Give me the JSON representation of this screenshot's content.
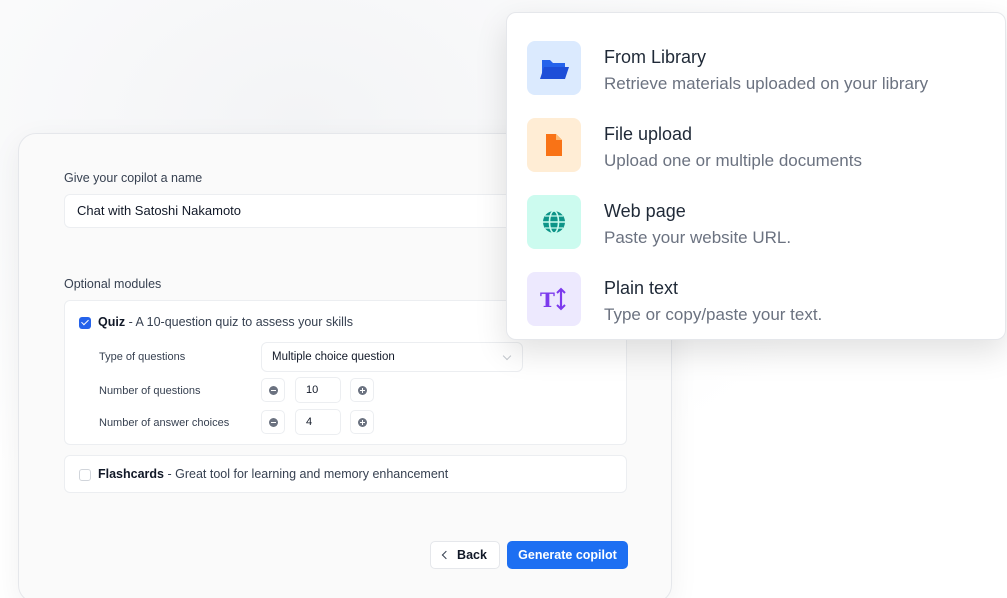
{
  "form": {
    "name_label": "Give your copilot a name",
    "name_value": "Chat with Satoshi Nakamoto",
    "modules_label": "Optional modules",
    "quiz": {
      "checked": true,
      "title": "Quiz",
      "description": " - A 10-question quiz to assess your skills",
      "type_label": "Type of questions",
      "type_value": "Multiple choice question",
      "num_questions_label": "Number of questions",
      "num_questions_value": "10",
      "num_choices_label": "Number of answer choices",
      "num_choices_value": "4"
    },
    "flashcards": {
      "checked": false,
      "title": "Flashcards",
      "description": " - Great tool for learning and memory enhancement"
    },
    "back_label": "Back",
    "generate_label": "Generate copilot"
  },
  "source_menu": {
    "options": [
      {
        "icon": "folder-icon",
        "title": "From Library",
        "subtitle": "Retrieve materials uploaded on your library",
        "bg": "#dbeafe",
        "fg": "#2563eb"
      },
      {
        "icon": "file-icon",
        "title": "File upload",
        "subtitle": "Upload one or multiple documents",
        "bg": "#ffedd5",
        "fg": "#f97316"
      },
      {
        "icon": "globe-icon",
        "title": "Web page",
        "subtitle": "Paste your website URL.",
        "bg": "#ccfbef",
        "fg": "#0d9488"
      },
      {
        "icon": "text-icon",
        "title": "Plain text",
        "subtitle": "Type or copy/paste your text.",
        "bg": "#ede9fe",
        "fg": "#7c3aed"
      }
    ]
  },
  "colors": {
    "primary": "#1d6ff2",
    "checkbox": "#2563eb"
  }
}
